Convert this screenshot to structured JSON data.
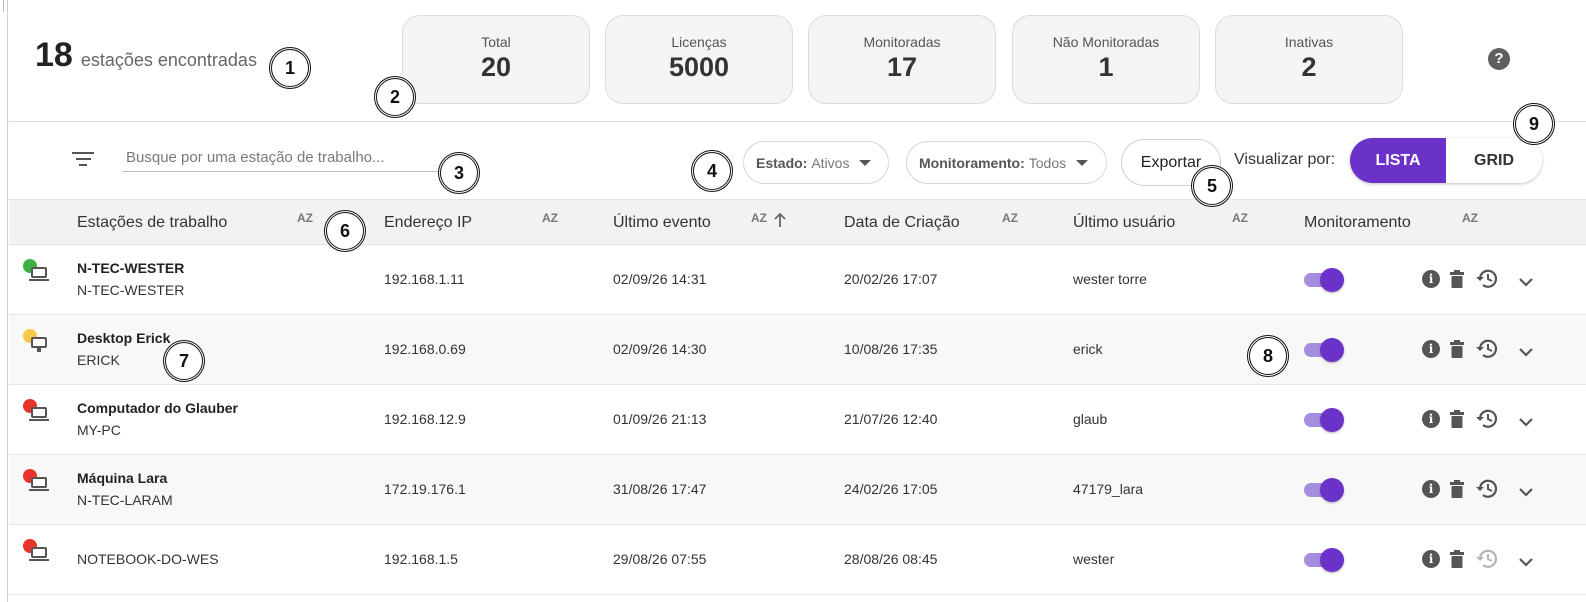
{
  "summary": {
    "count": "18",
    "label": "estações encontradas"
  },
  "stats": [
    {
      "title": "Total",
      "value": "20"
    },
    {
      "title": "Licenças",
      "value": "5000"
    },
    {
      "title": "Monitoradas",
      "value": "17"
    },
    {
      "title": "Não Monitoradas",
      "value": "1"
    },
    {
      "title": "Inativas",
      "value": "2"
    }
  ],
  "help_icon": "question-circle-icon",
  "toolbar": {
    "search_placeholder": "Busque por uma estação de trabalho...",
    "estado_label": "Estado:",
    "estado_value": "Ativos",
    "monitoramento_label": "Monitoramento:",
    "monitoramento_value": "Todos",
    "export_label": "Exportar",
    "view_label": "Visualizar por:",
    "view_list": "LISTA",
    "view_grid": "GRID",
    "view_selected": "LISTA"
  },
  "table": {
    "columns": [
      "Estações de trabalho",
      "Endereço IP",
      "Último evento",
      "Data de Criação",
      "Último usuário",
      "Monitoramento"
    ],
    "sort_label": "AZ",
    "sorted_column": "Último evento",
    "rows": [
      {
        "status": "online",
        "status_color": "#3cb043",
        "device": "laptop",
        "name": "N-TEC-WESTER",
        "host": "N-TEC-WESTER",
        "ip": "192.168.1.11",
        "last_event": "02/09/26 14:31",
        "created": "20/02/26 17:07",
        "user": "wester torre",
        "monitoring": true
      },
      {
        "status": "idle",
        "status_color": "#f7c948",
        "device": "desktop",
        "name": "Desktop Erick",
        "host": "ERICK",
        "ip": "192.168.0.69",
        "last_event": "02/09/26 14:30",
        "created": "10/08/26 17:35",
        "user": "erick",
        "monitoring": true
      },
      {
        "status": "offline",
        "status_color": "#e8342a",
        "device": "laptop",
        "name": "Computador do Glauber",
        "host": "MY-PC",
        "ip": "192.168.12.9",
        "last_event": "01/09/26 21:13",
        "created": "21/07/26 12:40",
        "user": "glaub",
        "monitoring": true
      },
      {
        "status": "offline",
        "status_color": "#e8342a",
        "device": "laptop",
        "name": "Máquina Lara",
        "host": "N-TEC-LARAM",
        "ip": "172.19.176.1",
        "last_event": "31/08/26 17:47",
        "created": "24/02/26 17:05",
        "user": "47179_lara",
        "monitoring": true
      },
      {
        "status": "offline",
        "status_color": "#e8342a",
        "device": "laptop",
        "name": "",
        "host": "NOTEBOOK-DO-WES",
        "ip": "192.168.1.5",
        "last_event": "29/08/26 07:55",
        "created": "28/08/26 08:45",
        "user": "wester",
        "monitoring": true
      }
    ]
  },
  "callouts": [
    "1",
    "2",
    "3",
    "4",
    "5",
    "6",
    "7",
    "8",
    "9"
  ],
  "colors": {
    "accent": "#6a32c9",
    "accent_light": "#a58ee0",
    "online": "#3cb043",
    "idle": "#f7c948",
    "offline": "#e8342a"
  }
}
